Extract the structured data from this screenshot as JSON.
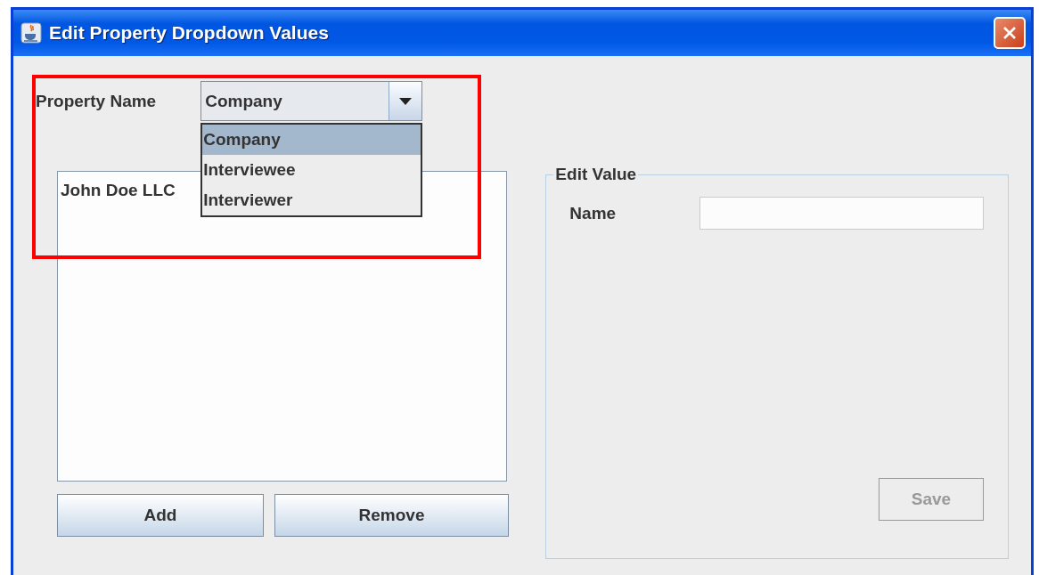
{
  "window": {
    "title": "Edit Property Dropdown Values"
  },
  "property": {
    "label": "Property Name",
    "value": "Company",
    "expanded": true,
    "options": [
      {
        "label": "Company",
        "selected": true
      },
      {
        "label": "Interviewee",
        "selected": false
      },
      {
        "label": "Interviewer",
        "selected": false
      }
    ]
  },
  "values_list": [
    {
      "label": "John Doe LLC",
      "selected": false
    }
  ],
  "list_buttons": [
    {
      "label": "Add",
      "disabled": false
    },
    {
      "label": "Remove",
      "disabled": false
    }
  ],
  "edit_value": {
    "title": "Edit Value",
    "name_label": "Name",
    "save": {
      "label": "Save",
      "disabled": true
    }
  },
  "annotation": {
    "highlighted": true
  }
}
